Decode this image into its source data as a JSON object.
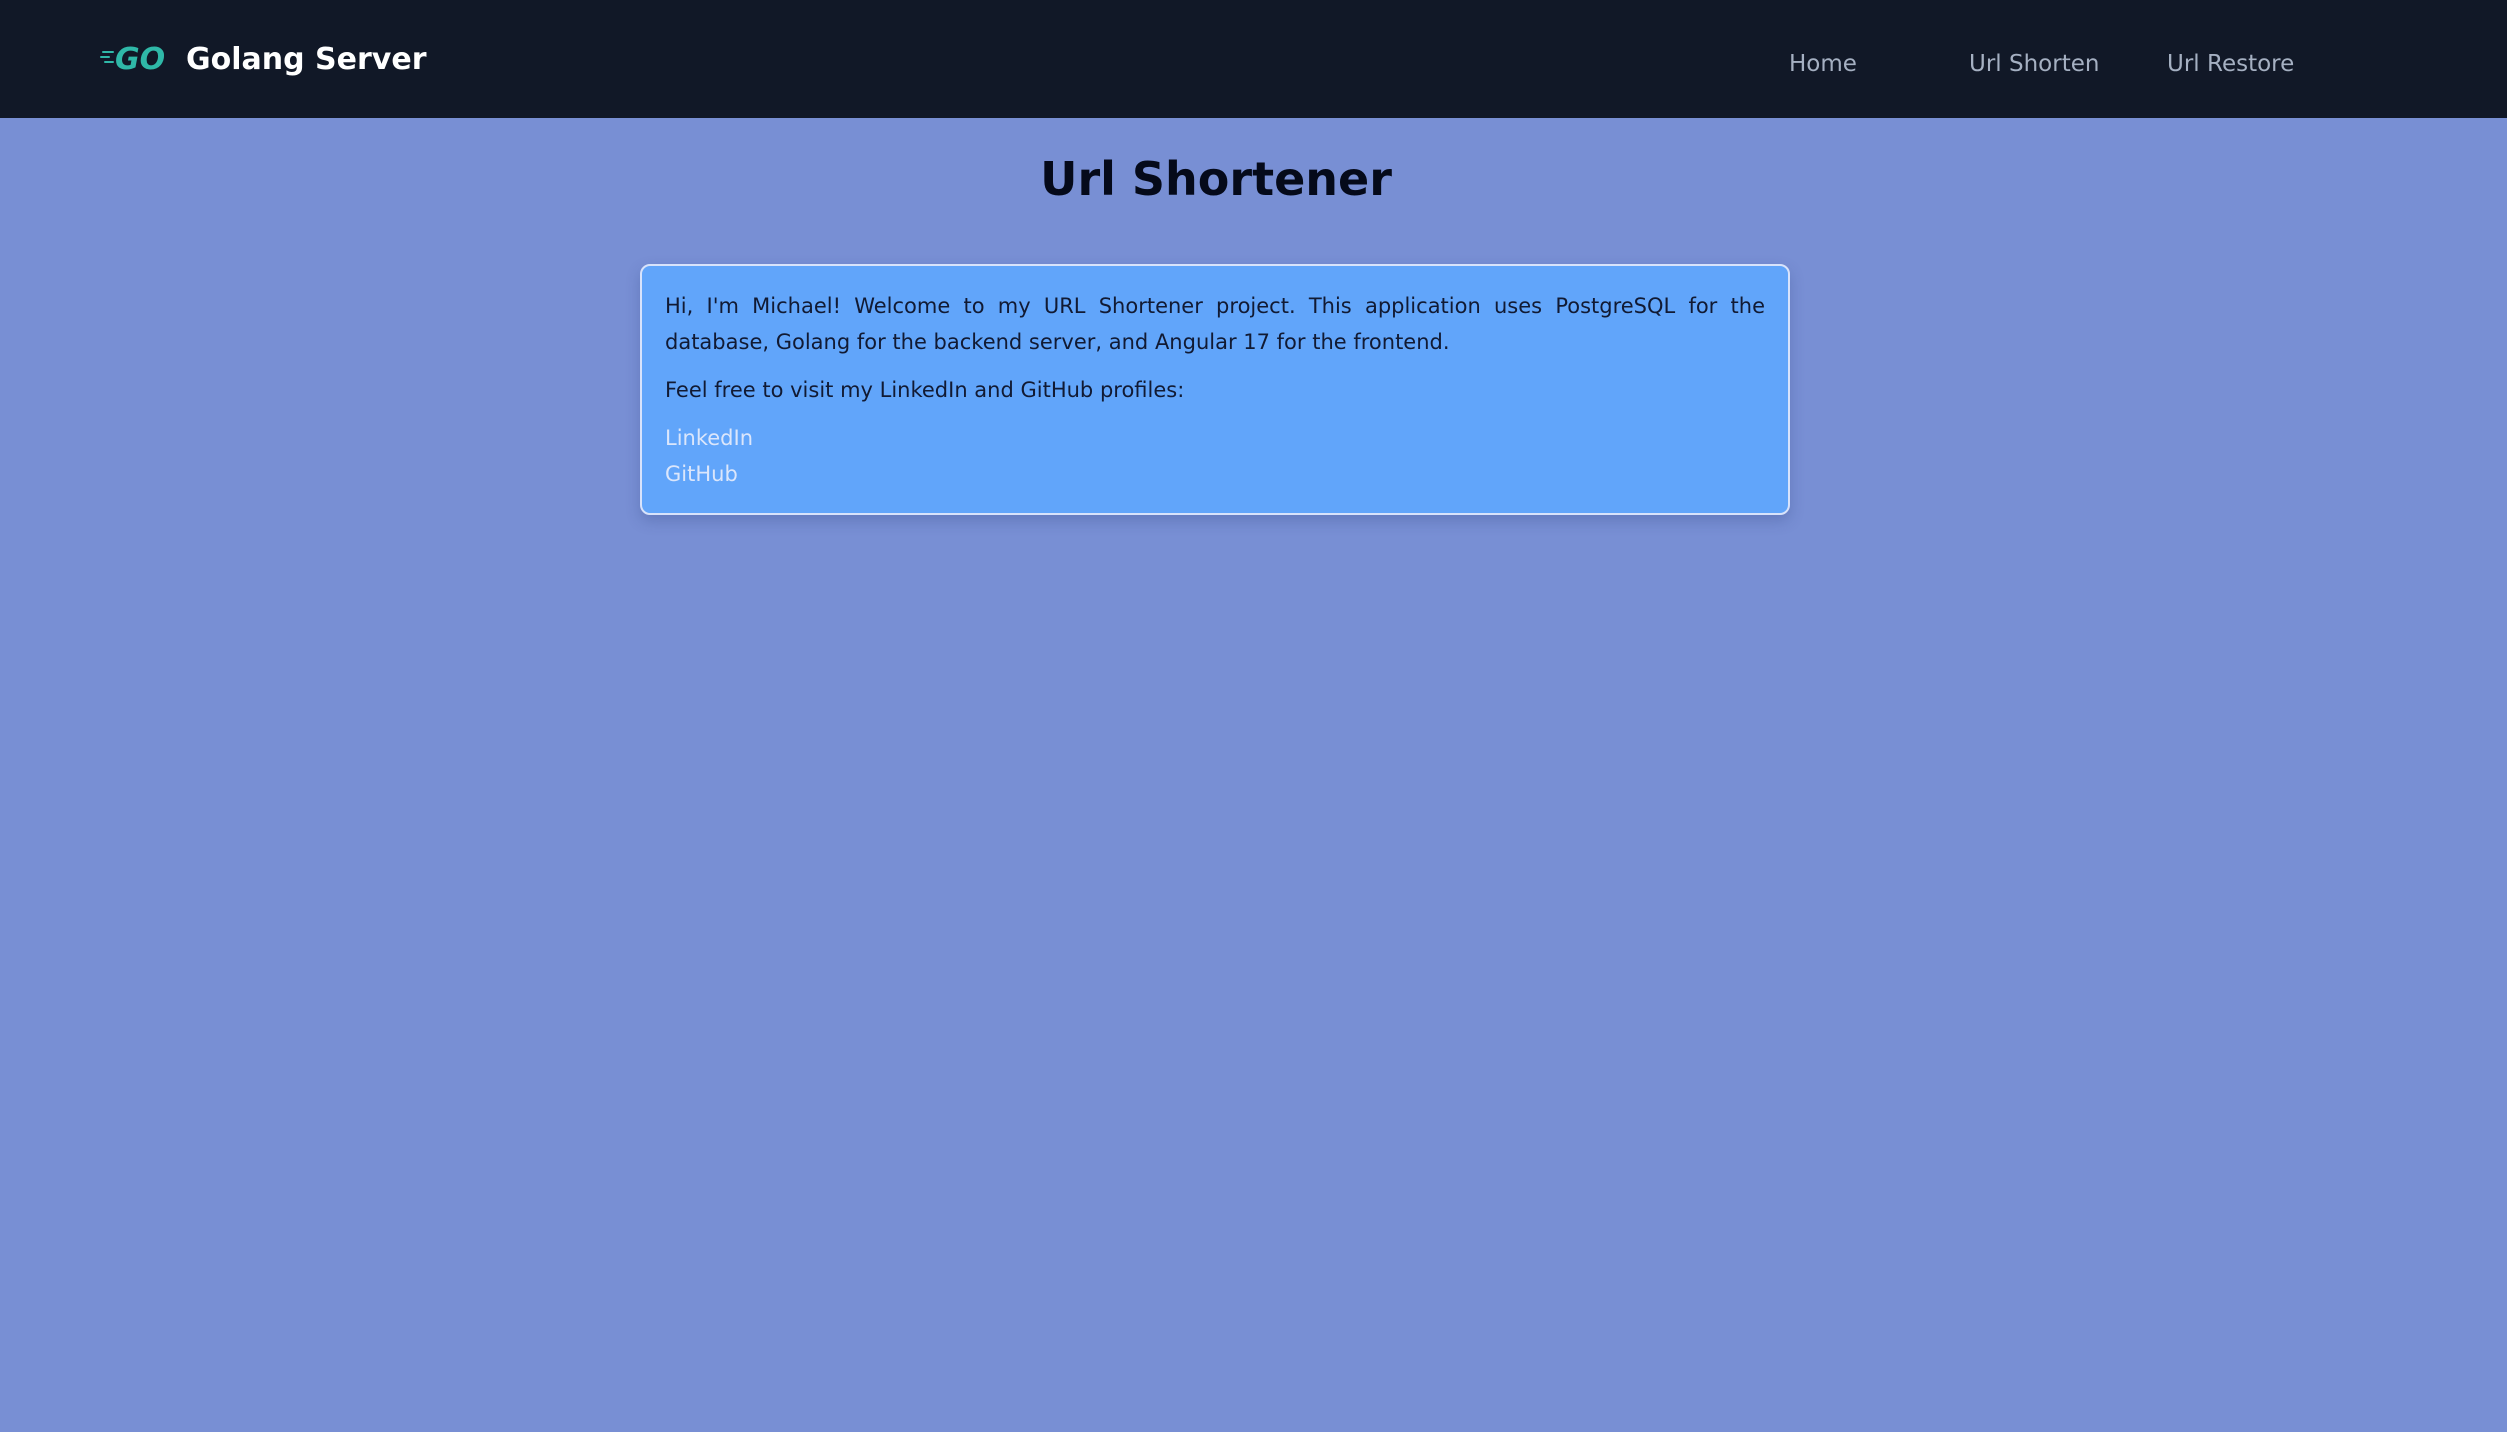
{
  "navbar": {
    "brand_logo_text": "GO",
    "brand_name": "Golang Server",
    "links": [
      {
        "label": "Home"
      },
      {
        "label": "Url Shorten"
      },
      {
        "label": "Url Restore"
      }
    ]
  },
  "main": {
    "title": "Url Shortener",
    "intro": "Hi, I'm Michael! Welcome to my URL Shortener project. This application uses PostgreSQL for the database, Golang for the backend server, and Angular 17 for the frontend.",
    "cta": "Feel free to visit my LinkedIn and GitHub profiles:",
    "profile_links": [
      {
        "label": "LinkedIn"
      },
      {
        "label": "GitHub"
      }
    ]
  },
  "colors": {
    "navbar_bg": "#111827",
    "page_bg": "#788fd4",
    "card_bg": "#61a5fa",
    "go_logo": "#2fb8a8"
  }
}
